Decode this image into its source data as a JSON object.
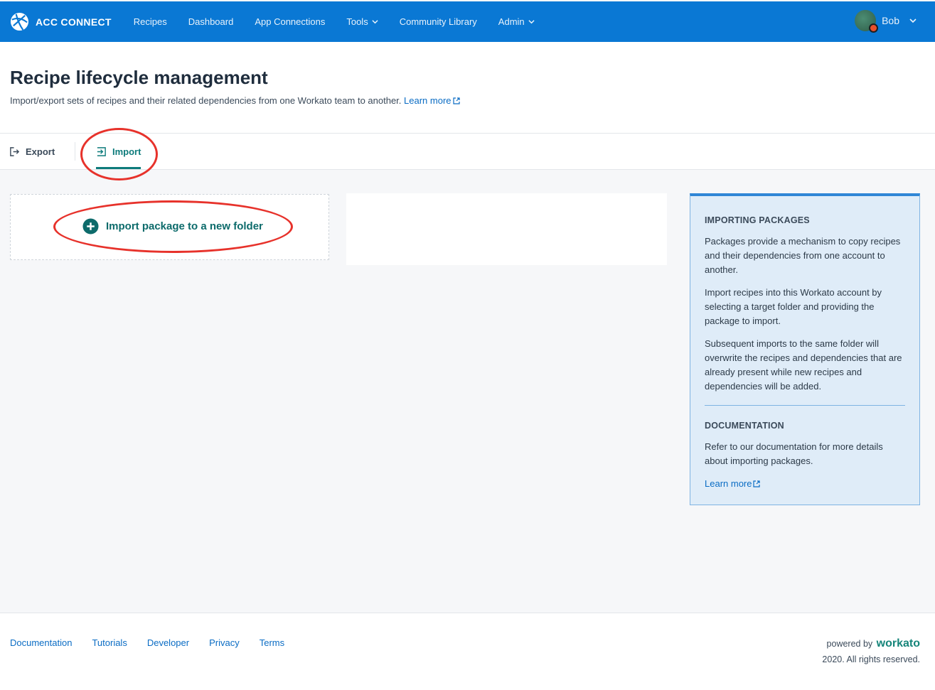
{
  "app": {
    "brand": "ACC CONNECT",
    "nav": [
      {
        "label": "Recipes"
      },
      {
        "label": "Dashboard"
      },
      {
        "label": "App Connections"
      },
      {
        "label": "Tools"
      },
      {
        "label": "Community Library"
      },
      {
        "label": "Admin"
      }
    ],
    "user": {
      "name": "Bob"
    }
  },
  "page": {
    "title": "Recipe lifecycle management",
    "description": "Import/export sets of recipes and their related dependencies from one Workato team to another.",
    "learn_more": "Learn more"
  },
  "tabs": {
    "export": "Export",
    "import": "Import",
    "active": "import"
  },
  "main": {
    "import_button": "Import package to a new folder"
  },
  "side_panel": {
    "heading1": "IMPORTING PACKAGES",
    "para1": "Packages provide a mechanism to copy recipes and their dependencies from one account to another.",
    "para2": "Import recipes into this Workato account by selecting a target folder and providing the package to import.",
    "para3": "Subsequent imports to the same folder will overwrite the recipes and dependencies that are already present while new recipes and dependencies will be added.",
    "heading2": "DOCUMENTATION",
    "para4": "Refer to our documentation for more details about importing packages.",
    "learn_more": "Learn more"
  },
  "footer": {
    "links": [
      "Documentation",
      "Tutorials",
      "Developer",
      "Privacy",
      "Terms"
    ],
    "powered_by": "powered by",
    "brand": "workato",
    "rights": "2020. All rights reserved."
  },
  "colors": {
    "header_bg": "#0a78d4",
    "accent_teal": "#0d7b7b",
    "link": "#0a6cc4",
    "annotation_red": "#e7322b",
    "panel_bg": "#dfecf8"
  },
  "icons": [
    "globe-logo-icon",
    "chevron-down-icon",
    "export-icon",
    "import-icon",
    "plus-circle-icon",
    "external-link-icon"
  ]
}
